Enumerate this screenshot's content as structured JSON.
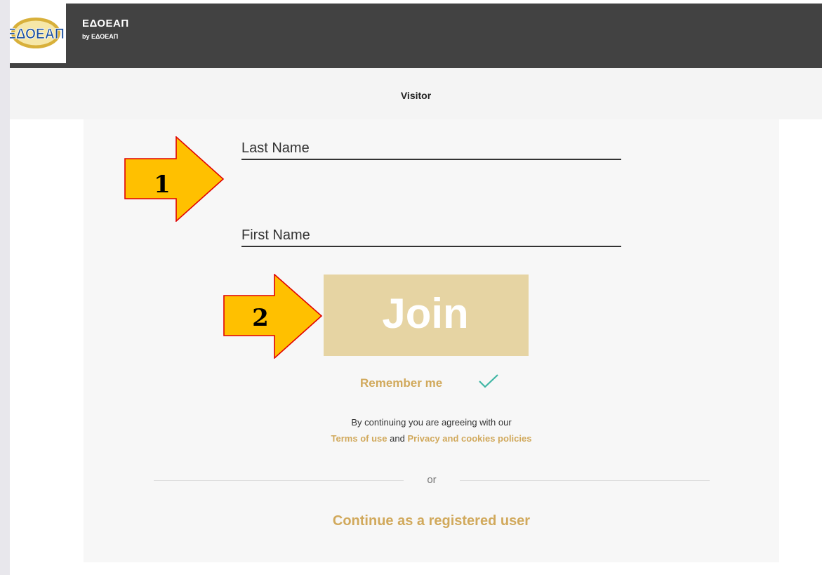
{
  "header": {
    "title": "ΕΔΟΕΑΠ",
    "subtitle": "by ΕΔΟΕΑΠ",
    "logo_text": "ΕΔΟΕΑΠ",
    "background_color": "#424242"
  },
  "subheader": {
    "label": "Visitor"
  },
  "form": {
    "last_name_placeholder": "Last Name",
    "first_name_placeholder": "First Name",
    "join_label": "Join",
    "remember_label": "Remember me",
    "remember_checked": true,
    "agree_text": "By continuing you are agreeing with our",
    "terms_link": "Terms of use",
    "and_text": "and",
    "privacy_link": "Privacy and cookies policies",
    "or_text": "or",
    "registered_link": "Continue as a registered user"
  },
  "annotations": {
    "step1": "1",
    "step2": "2"
  },
  "colors": {
    "accent_gold": "#d1a95c",
    "join_bg": "#e6d4a3",
    "check_teal": "#3fb6a4",
    "arrow_fill": "#ffc000",
    "arrow_stroke": "#e00000"
  }
}
